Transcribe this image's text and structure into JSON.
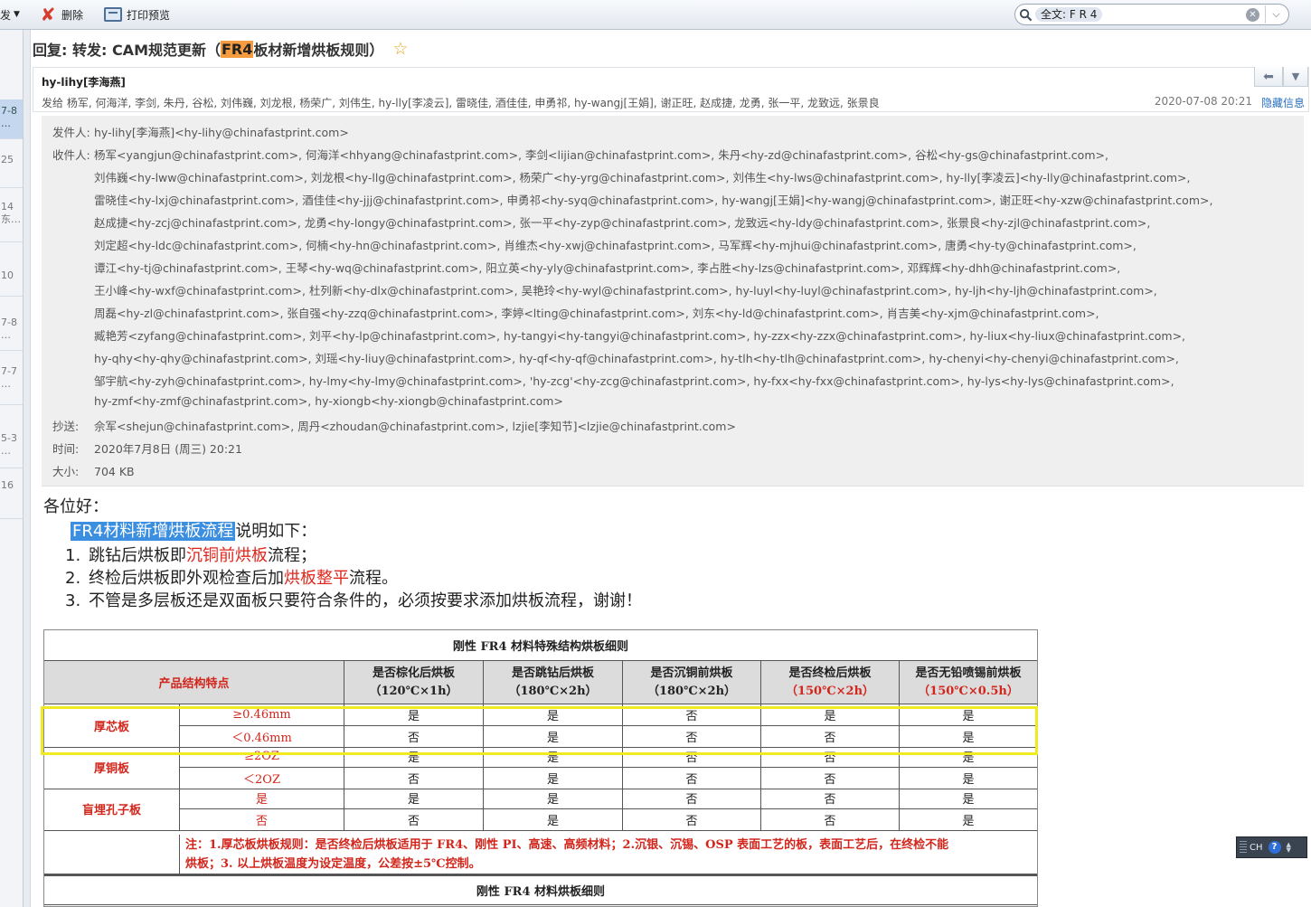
{
  "toolbar": {
    "partial_label": "发",
    "delete_label": "删除",
    "print_label": "打印预览"
  },
  "search": {
    "token": "全文: F R 4"
  },
  "left_list": [
    "7-8\n…",
    "25",
    "14\n东…",
    "10",
    "7-8\n…",
    "7-7\n…",
    "5-3\n…",
    "16"
  ],
  "email": {
    "subject_prefix": "回复: 转发: CAM规范更新（",
    "subject_hl": "FR4",
    "subject_suffix": "板材新增烘板规则）",
    "sender": "hy-lihy[李海燕]",
    "recipients_line": "发给 杨军, 何海洋, 李剑, 朱丹, 谷松, 刘伟巍, 刘龙根, 杨荣广, 刘伟生, hy-lly[李凌云], 雷晓佳, 酒佳佳, 申勇祁, hy-wangj[王娟], 谢正旺, 赵成捷, 龙勇, 张一平, 龙致远, 张景良",
    "datetime": "2020-07-08 20:21",
    "hide_info": "隐藏信息"
  },
  "details": {
    "from_label": "发件人:",
    "from": "hy-lihy[李海燕]<hy-lihy@chinafastprint.com>",
    "to_label": "收件人:",
    "to_lines": [
      "杨军<yangjun@chinafastprint.com>, 何海洋<hhyang@chinafastprint.com>, 李剑<lijian@chinafastprint.com>, 朱丹<hy-zd@chinafastprint.com>, 谷松<hy-gs@chinafastprint.com>,",
      "刘伟巍<hy-lww@chinafastprint.com>, 刘龙根<hy-llg@chinafastprint.com>, 杨荣广<hy-yrg@chinafastprint.com>, 刘伟生<hy-lws@chinafastprint.com>, hy-lly[李凌云]<hy-lly@chinafastprint.com>,",
      "雷晓佳<hy-lxj@chinafastprint.com>, 酒佳佳<hy-jjj@chinafastprint.com>, 申勇祁<hy-syq@chinafastprint.com>, hy-wangj[王娟]<hy-wangj@chinafastprint.com>, 谢正旺<hy-xzw@chinafastprint.com>,",
      "赵成捷<hy-zcj@chinafastprint.com>, 龙勇<hy-longy@chinafastprint.com>, 张一平<hy-zyp@chinafastprint.com>, 龙致远<hy-ldy@chinafastprint.com>, 张景良<hy-zjl@chinafastprint.com>,",
      "刘定超<hy-ldc@chinafastprint.com>, 何楠<hy-hn@chinafastprint.com>, 肖维杰<hy-xwj@chinafastprint.com>, 马军辉<hy-mjhui@chinafastprint.com>, 唐勇<hy-ty@chinafastprint.com>,",
      "谭江<hy-tj@chinafastprint.com>, 王琴<hy-wq@chinafastprint.com>, 阳立英<hy-yly@chinafastprint.com>, 李占胜<hy-lzs@chinafastprint.com>, 邓辉辉<hy-dhh@chinafastprint.com>,",
      "王小峰<hy-wxf@chinafastprint.com>, 杜列新<hy-dlx@chinafastprint.com>, 吴艳玲<hy-wyl@chinafastprint.com>, hy-luyl<hy-luyl@chinafastprint.com>, hy-ljh<hy-ljh@chinafastprint.com>,",
      "周磊<hy-zl@chinafastprint.com>, 张自强<hy-zzq@chinafastprint.com>, 李婷<lting@chinafastprint.com>, 刘东<hy-ld@chinafastprint.com>, 肖吉美<hy-xjm@chinafastprint.com>,",
      "臧艳芳<zyfang@chinafastprint.com>, 刘平<hy-lp@chinafastprint.com>, hy-tangyi<hy-tangyi@chinafastprint.com>, hy-zzx<hy-zzx@chinafastprint.com>, hy-liux<hy-liux@chinafastprint.com>,",
      "hy-qhy<hy-qhy@chinafastprint.com>, 刘瑶<hy-liuy@chinafastprint.com>, hy-qf<hy-qf@chinafastprint.com>, hy-tlh<hy-tlh@chinafastprint.com>, hy-chenyi<hy-chenyi@chinafastprint.com>,",
      "邹宇航<hy-zyh@chinafastprint.com>, hy-lmy<hy-lmy@chinafastprint.com>, 'hy-zcg'<hy-zcg@chinafastprint.com>, hy-fxx<hy-fxx@chinafastprint.com>, hy-lys<hy-lys@chinafastprint.com>,",
      "hy-zmf<hy-zmf@chinafastprint.com>, hy-xiongb<hy-xiongb@chinafastprint.com>"
    ],
    "cc_label": "抄送:",
    "cc": "佘军<shejun@chinafastprint.com>, 周丹<zhoudan@chinafastprint.com>, lzjie[李知节]<lzjie@chinafastprint.com>",
    "time_label": "时间:",
    "time": "2020年7月8日 (周三) 20:21",
    "size_label": "大小:",
    "size": "704 KB"
  },
  "body": {
    "greeting": "各位好：",
    "intro_hl": "FR4材料新增烘板流程",
    "intro_rest": "说明如下：",
    "items": [
      {
        "num": "1.",
        "pre": "跳钻后烘板即",
        "red": "沉铜前烘板",
        "post": "流程；"
      },
      {
        "num": "2.",
        "pre": "终检后烘板即外观检查后加",
        "red": "烘板整平",
        "post": "流程。"
      },
      {
        "num": "3.",
        "pre": "不管是多层板还是双面板只要符合条件的，必须按要求添加烘板流程，谢谢！",
        "red": "",
        "post": ""
      }
    ]
  },
  "table": {
    "title": "刚性 FR4 材料特殊结构烘板细则",
    "feature_header": "产品结构特点",
    "cols": [
      {
        "name": "是否棕化后烘板",
        "cond": "（120℃×1h）",
        "red": false
      },
      {
        "name": "是否跳钻后烘板",
        "cond": "（180℃×2h）",
        "red": false
      },
      {
        "name": "是否沉铜前烘板",
        "cond": "（180℃×2h）",
        "red": false
      },
      {
        "name": "是否终检后烘板",
        "cond": "（150℃×2h）",
        "red": true
      },
      {
        "name": "是否无铅喷锡前烘板",
        "cond": "（150℃×0.5h）",
        "red": true
      }
    ],
    "groups": [
      {
        "name": "厚芯板",
        "rows": [
          {
            "sub": "≥0.46mm",
            "v": [
              "是",
              "是",
              "否",
              "是",
              "是"
            ]
          },
          {
            "sub": "＜0.46mm",
            "v": [
              "否",
              "是",
              "否",
              "否",
              "是"
            ]
          }
        ]
      },
      {
        "name": "厚铜板",
        "rows": [
          {
            "sub": "≥2OZ",
            "v": [
              "是",
              "是",
              "否",
              "否",
              "是"
            ]
          },
          {
            "sub": "＜2OZ",
            "v": [
              "否",
              "是",
              "否",
              "否",
              "是"
            ]
          }
        ]
      },
      {
        "name": "盲埋孔子板",
        "rows": [
          {
            "sub": "是",
            "v": [
              "是",
              "是",
              "否",
              "否",
              "是"
            ]
          },
          {
            "sub": "否",
            "v": [
              "否",
              "是",
              "否",
              "否",
              "是"
            ]
          }
        ]
      }
    ],
    "note_line1": "注：1.厚芯板烘板规则：是否终检后烘板适用于 FR4、刚性 PI、高速、高频材料；2.沉银、沉锡、OSP 表面工艺的板，表面工艺后，在终检不能",
    "note_line2": "烘板；3. 以上烘板温度为设定温度，公差按±5℃控制。",
    "title2": "刚性 FR4 材料烘板细则"
  },
  "ime": {
    "label": "CH",
    "help": "?"
  }
}
